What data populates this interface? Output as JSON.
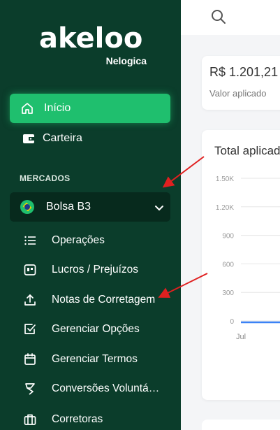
{
  "brand": {
    "name": "akeloo",
    "sub": "Nelogica"
  },
  "nav": {
    "inicio": "Início",
    "carteira": "Carteira"
  },
  "section": {
    "mercados": "MERCADOS"
  },
  "market": {
    "label": "Bolsa B3"
  },
  "submenu": [
    {
      "label": "Operações",
      "icon": "list-icon"
    },
    {
      "label": "Lucros / Prejuízos",
      "icon": "chart-card-icon"
    },
    {
      "label": "Notas de Corretagem",
      "icon": "upload-icon"
    },
    {
      "label": "Gerenciar Opções",
      "icon": "checkbox-icon"
    },
    {
      "label": "Gerenciar Termos",
      "icon": "calendar-icon"
    },
    {
      "label": "Conversões Voluntárias",
      "icon": "filter-icon"
    },
    {
      "label": "Corretoras",
      "icon": "briefcase-icon"
    }
  ],
  "stat": {
    "value": "R$ 1.201,21",
    "label": "Valor aplicado"
  },
  "chart_data": {
    "type": "line",
    "title": "Total aplicado",
    "yticks": [
      "1.50K",
      "1.20K",
      "900",
      "600",
      "300",
      "0"
    ],
    "ylim": [
      0,
      1500
    ],
    "xticks": [
      "Jul"
    ],
    "series": [
      {
        "values": [
          0
        ]
      }
    ]
  },
  "colors": {
    "sidebar": "#0b3d2b",
    "accent": "#1fbf6e",
    "arrow": "#e02020"
  }
}
